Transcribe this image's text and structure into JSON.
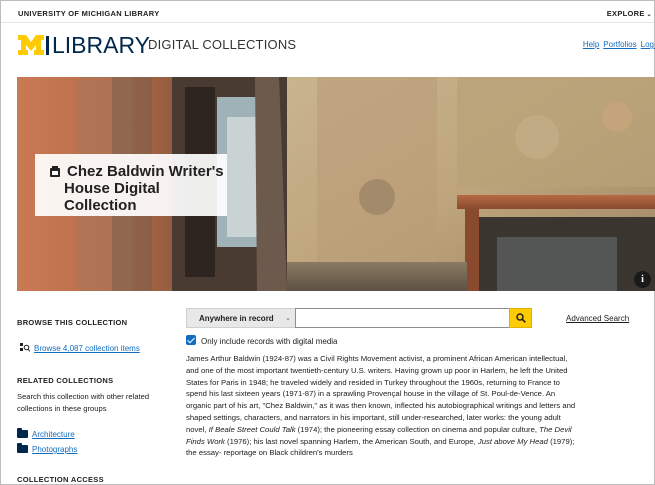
{
  "utility_bar": {
    "university_label": "UNIVERSITY OF MICHIGAN LIBRARY",
    "explore_label": "EXPLORE"
  },
  "header": {
    "logo_library": "LIBRARY",
    "digital_collections": "DIGITAL COLLECTIONS",
    "links": [
      "Help",
      "Portfolios",
      "Log i"
    ]
  },
  "hero": {
    "title_line1": "Chez Baldwin Writer's",
    "title_line2": "House Digital Collection",
    "info_label": "i"
  },
  "sidebar": {
    "browse_heading": "BROWSE THIS COLLECTION",
    "browse_link": "Browse 4,087 collection items",
    "related_heading": "RELATED COLLECTIONS",
    "related_text": "Search this collection with other related collections in these groups",
    "related_groups": [
      "Architecture",
      "Photographs"
    ],
    "access_heading": "COLLECTION ACCESS"
  },
  "search": {
    "scope_selected": "Anywhere in record",
    "query_value": "",
    "advanced_search_label": "Advanced Search",
    "checkbox_label": "Only include records with digital media",
    "checkbox_checked": true
  },
  "description": {
    "seg1": "James Arthur Baldwin (1924-87) was a Civil Rights Movement activist, a prominent African American intellectual, and one of the most important twentieth-century U.S. writers. Having grown up poor in Harlem, he left the United States for Paris in 1948; he traveled widely and resided in Turkey throughout the 1960s, returning to France to spend his last sixteen years (1971-87) in a sprawling Provençal house in the village of St. Poul-de-Vence. An organic part of his art, \"Chez Baldwin,\" as it was then known, inflected his autobiographical writings and letters and shaped settings, characters, and narrators in his important, still under-researched, later works: the young adult novel, ",
    "title1": "If Beale Street Could Talk",
    "seg2": " (1974); the pioneering essay collection on cinema and popular culture, ",
    "title2": "The Devil Finds Work",
    "seg3": " (1976); his last novel spanning Harlem, the American South, and Europe, ",
    "title3": "Just above My Head",
    "seg4": " (1979); the essay- reportage on Black children's murders"
  },
  "colors": {
    "brand_blue": "#00274c",
    "maize": "#ffcb05",
    "link_blue": "#126dc1",
    "checkbox_blue": "#126dc1"
  },
  "icons": {
    "logo": "block-m-logo",
    "title": "collection-icon",
    "browse": "browse-icon",
    "folder": "folder-icon",
    "search": "search-icon",
    "info": "info-icon"
  }
}
